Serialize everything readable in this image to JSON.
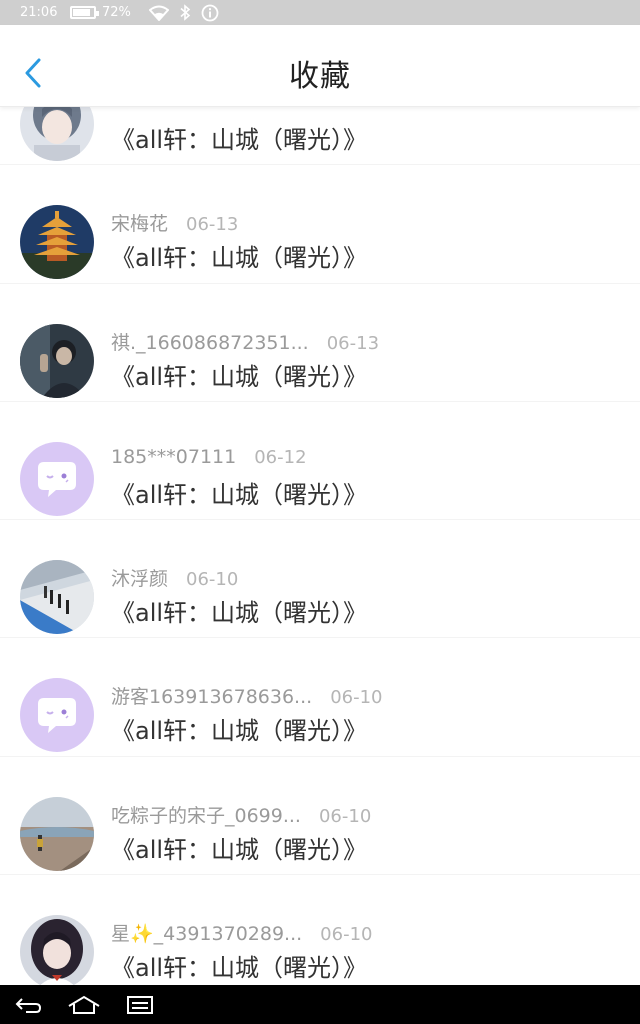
{
  "status_bar": {
    "time": "21:06",
    "battery": "72%",
    "battery_level": 0.72
  },
  "header": {
    "title": "收藏",
    "accent": "#2b9ae0"
  },
  "items": [
    {
      "nickname": "",
      "date": "",
      "work": "《all轩：山城（曙光）》",
      "avatar": "anime-girl"
    },
    {
      "nickname": "宋梅花",
      "date": "06-13",
      "work": "《all轩：山城（曙光）》",
      "avatar": "pagoda"
    },
    {
      "nickname": "祺._166086872351...",
      "date": "06-13",
      "work": "《all轩：山城（曙光）》",
      "avatar": "dark-portrait"
    },
    {
      "nickname": "185***07111",
      "date": "06-12",
      "work": "《all轩：山城（曙光）》",
      "avatar": "default-chat"
    },
    {
      "nickname": "沐浮颜",
      "date": "06-10",
      "work": "《all轩：山城（曙光）》",
      "avatar": "train-platform"
    },
    {
      "nickname": "游客163913678636...",
      "date": "06-10",
      "work": "《all轩：山城（曙光）》",
      "avatar": "default-chat"
    },
    {
      "nickname": "吃粽子的宋子_0699...",
      "date": "06-10",
      "work": "《all轩：山城（曙光）》",
      "avatar": "landscape"
    },
    {
      "nickname": "星✨_4391370289...",
      "date": "06-10",
      "work": "《all轩：山城（曙光）》",
      "avatar": "anime-girl-dark"
    }
  ],
  "nav_bar": {
    "back": "back-icon",
    "home": "home-icon",
    "recent": "recent-apps-icon"
  }
}
